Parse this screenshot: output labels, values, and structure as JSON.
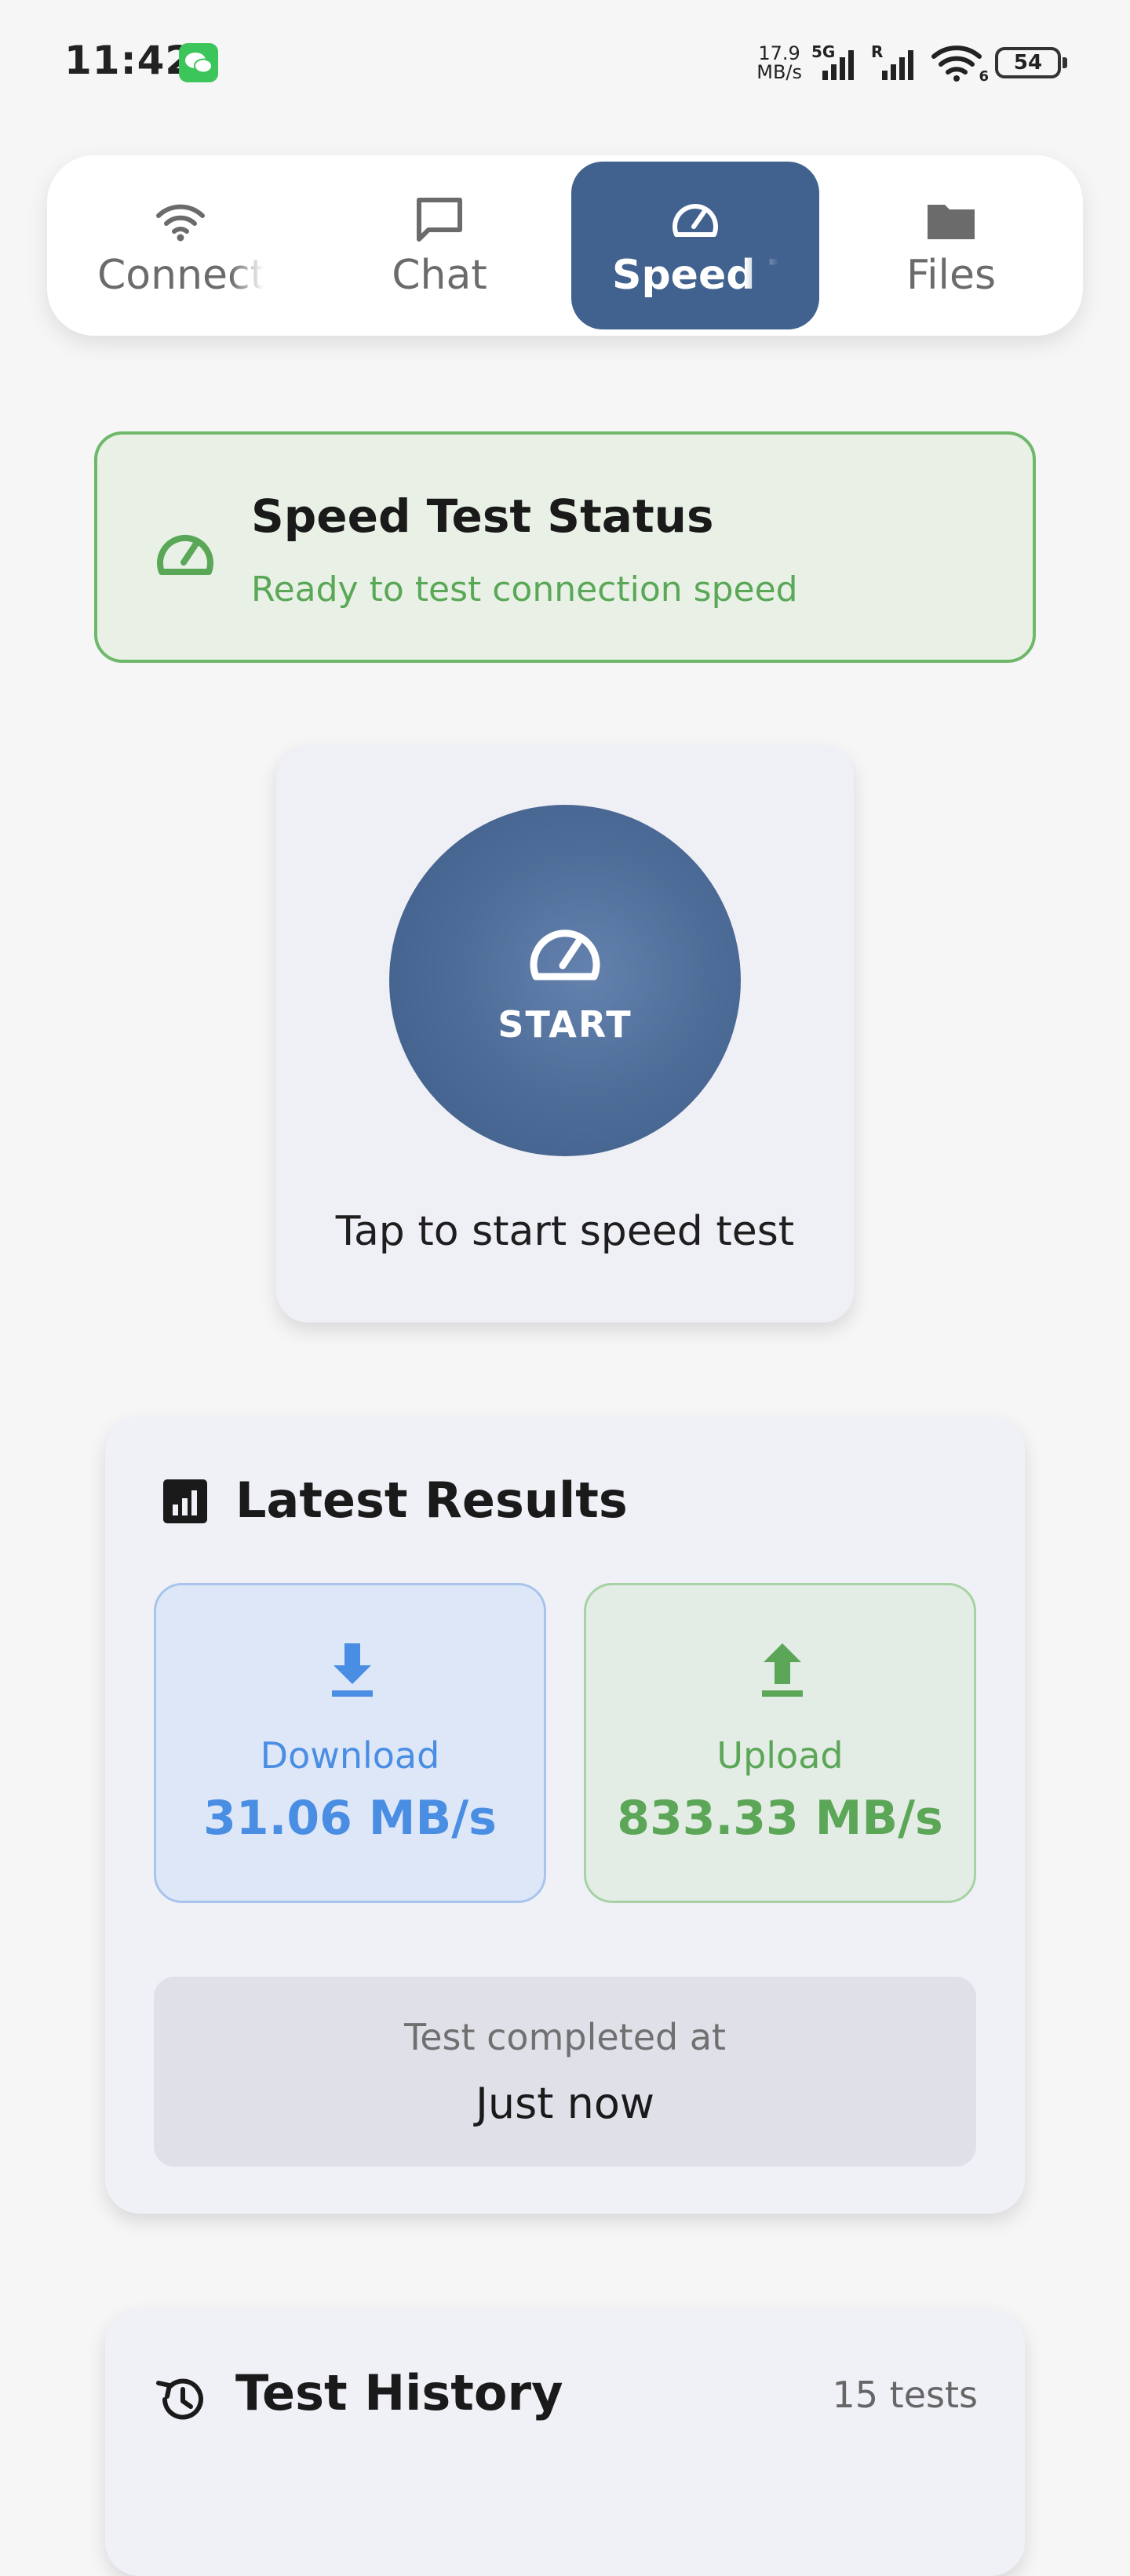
{
  "status_bar": {
    "time": "11:42",
    "net_speed_value": "17.9",
    "net_speed_unit": "MB/s",
    "signal1_tag": "5G",
    "signal2_tag": "R",
    "wifi_tag": "6",
    "battery": "54"
  },
  "tabs": [
    {
      "label": "Connect",
      "icon": "wifi-icon",
      "active": false
    },
    {
      "label": "Chat",
      "icon": "chat-icon",
      "active": false
    },
    {
      "label": "Speed Test",
      "icon": "speedometer-icon",
      "active": true
    },
    {
      "label": "Files",
      "icon": "folder-icon",
      "active": false
    }
  ],
  "status_card": {
    "title": "Speed Test Status",
    "subtitle": "Ready to test connection speed",
    "icon": "speedometer-icon",
    "accent": "#5aa857"
  },
  "start": {
    "label": "START",
    "hint": "Tap to start speed test",
    "color": "#41628f"
  },
  "latest": {
    "title": "Latest Results",
    "icon": "bar-chart-icon",
    "download": {
      "label": "Download",
      "value": "31.06 MB/s",
      "color": "#4a8ee3",
      "icon": "download-icon"
    },
    "upload": {
      "label": "Upload",
      "value": "833.33 MB/s",
      "color": "#5ba657",
      "icon": "upload-icon"
    },
    "completed_label": "Test completed at",
    "completed_value": "Just now"
  },
  "history": {
    "title": "Test History",
    "icon": "history-icon",
    "count": "15 tests"
  }
}
